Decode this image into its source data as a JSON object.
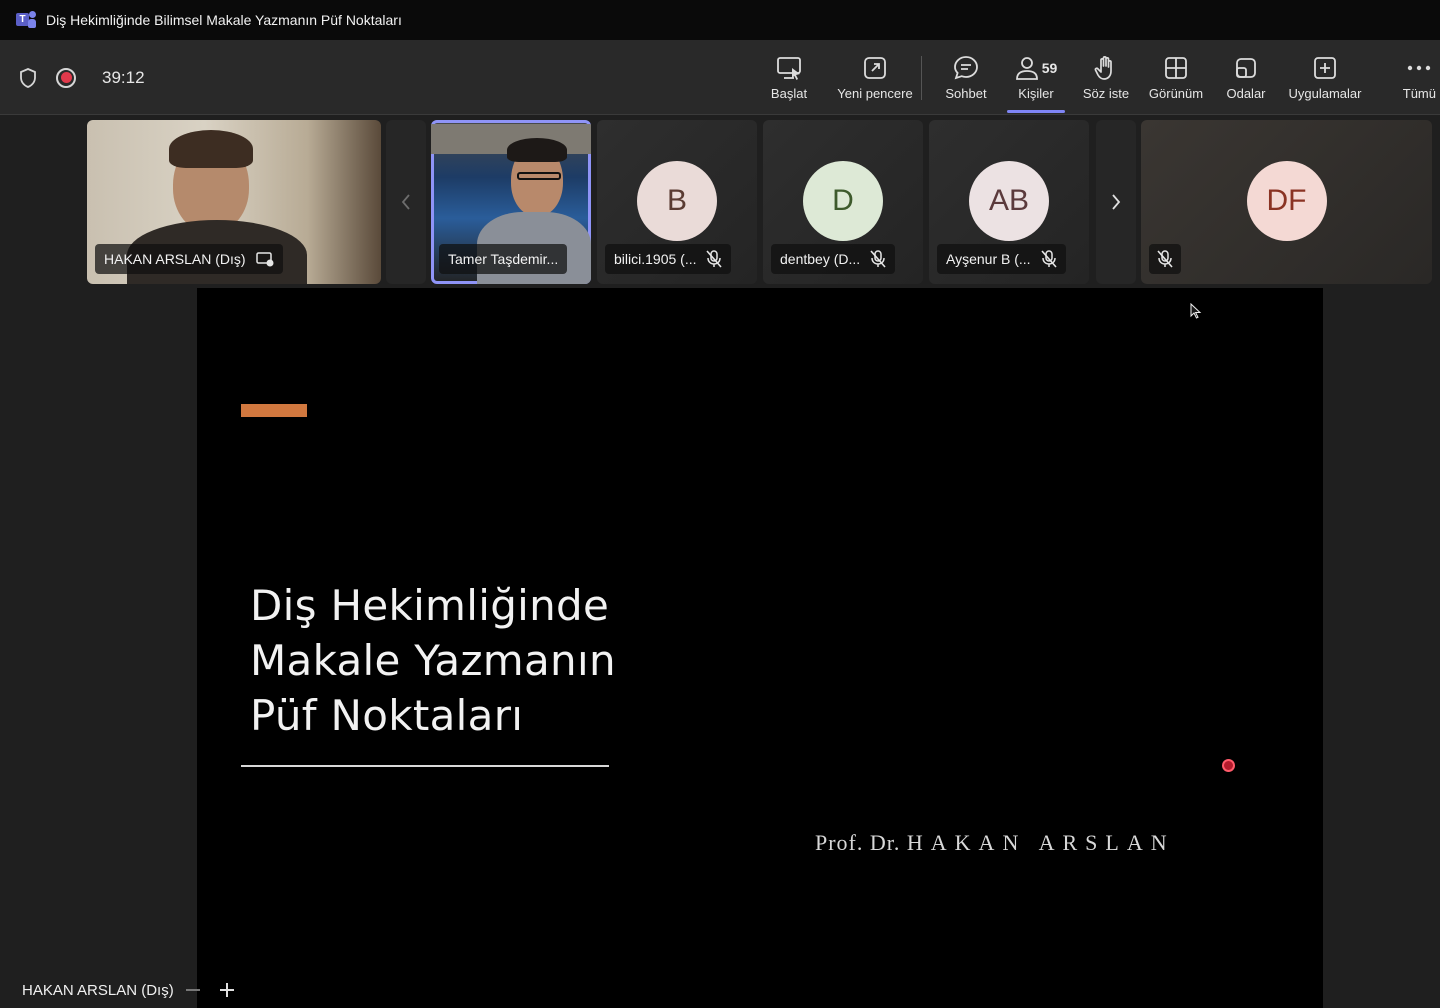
{
  "window": {
    "title": "Diş Hekimliğinde Bilimsel Makale Yazmanın Püf Noktaları"
  },
  "toolbar": {
    "timer": "39:12",
    "buttons": [
      {
        "label": "Başlat",
        "icon": "share-screen-icon"
      },
      {
        "label": "Yeni pencere",
        "icon": "pop-out-icon"
      },
      {
        "label": "Sohbet",
        "icon": "chat-icon"
      },
      {
        "label": "Kişiler",
        "icon": "people-icon",
        "count": "59",
        "active": true
      },
      {
        "label": "Söz iste",
        "icon": "raise-hand-icon"
      },
      {
        "label": "Görünüm",
        "icon": "view-grid-icon"
      },
      {
        "label": "Odalar",
        "icon": "rooms-icon"
      },
      {
        "label": "Uygulamalar",
        "icon": "add-apps-icon"
      },
      {
        "label": "Tümü",
        "icon": "more-icon"
      }
    ]
  },
  "participants": [
    {
      "name": "HAKAN ARSLAN (Dış)",
      "type": "video"
    },
    {
      "name": "Tamer Taşdemir...",
      "type": "video",
      "selected": true
    },
    {
      "name": "bilici.1905 (...",
      "initials": "B",
      "avatar_bg": "#eadbd8",
      "avatar_fg": "#5a3b32",
      "muted": true
    },
    {
      "name": "dentbey (D...",
      "initials": "D",
      "avatar_bg": "#dde9d6",
      "avatar_fg": "#3d5a2c",
      "muted": true
    },
    {
      "name": "Ayşenur B (...",
      "initials": "AB",
      "avatar_bg": "#ece2e3",
      "avatar_fg": "#5b3a3c",
      "muted": true
    },
    {
      "name": "",
      "initials": "DF",
      "avatar_bg": "#f4d9d4",
      "avatar_fg": "#8a3323",
      "muted": true
    }
  ],
  "slide": {
    "title_lines": [
      "Diş Hekimliğinde",
      "Makale Yazmanın",
      "Püf Noktaları"
    ],
    "author_prefix": "Prof. Dr.",
    "author_name": "HAKAN ARSLAN",
    "accent_color": "#d1783f"
  },
  "presenter_tag": {
    "name": "HAKAN ARSLAN (Dış)"
  }
}
